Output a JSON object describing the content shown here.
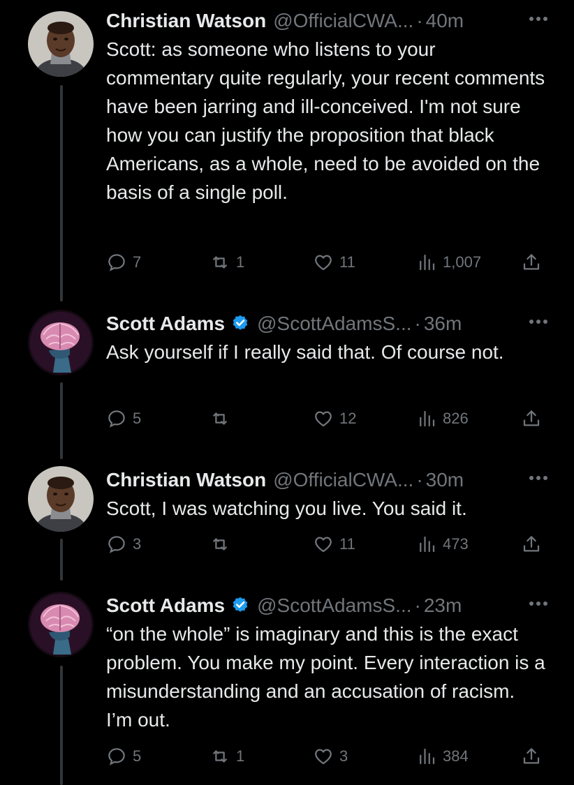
{
  "colors": {
    "background": "#000000",
    "text_primary": "#e7e9ea",
    "text_secondary": "#71767b",
    "verified_blue": "#1d9bf0",
    "thread_line": "#333639"
  },
  "tweets": [
    {
      "name": "Christian Watson",
      "verified": false,
      "handle": "@OfficialCWA...",
      "separator": "·",
      "time": "40m",
      "text": "Scott: as someone who listens to your commentary quite regularly, your recent comments have been jarring and ill-conceived. I'm not sure how you can justify the proposition that black Americans, as a whole, need to be avoided on the basis of a single poll.",
      "replies": "7",
      "retweets": "1",
      "likes": "11",
      "views": "1,007",
      "avatar": "portrait-man-avatar"
    },
    {
      "name": "Scott Adams",
      "verified": true,
      "handle": "@ScottAdamsS...",
      "separator": "·",
      "time": "36m",
      "text": "Ask yourself if I really said that. Of course not.",
      "replies": "5",
      "retweets": "",
      "likes": "12",
      "views": "826",
      "avatar": "brain-head-avatar"
    },
    {
      "name": "Christian Watson",
      "verified": false,
      "handle": "@OfficialCWA...",
      "separator": "·",
      "time": "30m",
      "text": "Scott, I was watching you live. You said it.",
      "replies": "3",
      "retweets": "",
      "likes": "11",
      "views": "473",
      "avatar": "portrait-man-avatar"
    },
    {
      "name": "Scott Adams",
      "verified": true,
      "handle": "@ScottAdamsS...",
      "separator": "·",
      "time": "23m",
      "text": "“on the whole” is imaginary and this is the exact problem. You make my point. Every interaction is a misunderstanding and an accusation of racism. I’m out.",
      "replies": "5",
      "retweets": "1",
      "likes": "3",
      "views": "384",
      "avatar": "brain-head-avatar"
    }
  ]
}
